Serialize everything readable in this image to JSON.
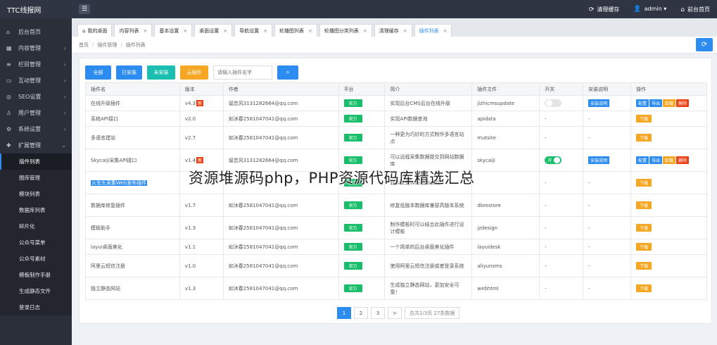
{
  "app": {
    "logo": "TTC线报网"
  },
  "header": {
    "menu_icon": "menu-icon",
    "clear_cache": "清理缓存",
    "user": "admin",
    "frontend": "前台首页"
  },
  "sidebar": {
    "items": [
      {
        "label": "后台首页",
        "icon": "home-icon",
        "chev": ""
      },
      {
        "label": "内容管理",
        "icon": "grid-icon",
        "chev": "›"
      },
      {
        "label": "栏目管理",
        "icon": "list-icon",
        "chev": "›"
      },
      {
        "label": "互动管理",
        "icon": "chat-icon",
        "chev": "›"
      },
      {
        "label": "SEO设置",
        "icon": "seo-icon",
        "chev": "›"
      },
      {
        "label": "用户管理",
        "icon": "user-icon",
        "chev": "›"
      },
      {
        "label": "系统设置",
        "icon": "gear-icon",
        "chev": "›"
      },
      {
        "label": "扩展管理",
        "icon": "puzzle-icon",
        "chev": "⌄"
      }
    ],
    "subitems": [
      "插件列表",
      "图库管理",
      "模块列表",
      "数据库列表",
      "碎片化",
      "公众号菜单",
      "公众号素材",
      "模板制作手册",
      "生成静态文件",
      "登录日志"
    ]
  },
  "tabs": [
    {
      "label": "我的桌面",
      "home": true
    },
    {
      "label": "内容列表"
    },
    {
      "label": "基本设置"
    },
    {
      "label": "桌面设置"
    },
    {
      "label": "导航设置"
    },
    {
      "label": "轮播图列表"
    },
    {
      "label": "轮播图分类列表"
    },
    {
      "label": "清理缓存"
    },
    {
      "label": "插件列表",
      "active": true
    }
  ],
  "breadcrumb": [
    "首页",
    "插件管理",
    "插件列表"
  ],
  "toolbar": {
    "all": "全部",
    "installed": "已安装",
    "not_installed": "未安装",
    "cloud": "云插件",
    "search_placeholder": "请输入插件名字"
  },
  "table": {
    "headers": [
      "插件名",
      "版本",
      "作者",
      "平台",
      "简介",
      "插件文件",
      "开关",
      "安装说明",
      "操作"
    ],
    "rows": [
      {
        "name": "在线升级插件",
        "version": "v4.3",
        "badge": "新",
        "author": "留恋风3131282664@qq.com",
        "platform": "官方",
        "intro": "实现后台CMS后台在线升级",
        "file": "jizhicmsupdate",
        "switch": "off",
        "explain": "安装说明",
        "ops": [
          "配置",
          "导出",
          "卸载",
          "删除"
        ]
      },
      {
        "name": "系统API接口",
        "version": "v2.0",
        "badge": "",
        "author": "如沐春2581047041@qq.com",
        "platform": "官方",
        "intro": "实现API数据查询",
        "file": "apidata",
        "switch": "-",
        "explain": "-",
        "ops": [
          "下载"
        ]
      },
      {
        "name": "多语言建站",
        "version": "v2.7",
        "badge": "",
        "author": "如沐春2581047041@qq.com",
        "platform": "官方",
        "intro": "一种更为巧妙的方式制作多语言站点",
        "file": "mutsite",
        "switch": "-",
        "explain": "-",
        "ops": [
          "下载"
        ]
      },
      {
        "name": "Skycaiji采集API接口",
        "version": "v1.4",
        "badge": "新",
        "author": "留恋风3131282664@qq.com",
        "platform": "官方",
        "intro": "可以远程采集数据提交到网站数据库",
        "file": "skycaiji",
        "switch": "on",
        "switch_label": "开",
        "explain": "安装说明",
        "ops": [
          "配置",
          "导出",
          "卸载",
          "删除"
        ]
      },
      {
        "name": "火车头采集Web发布插件",
        "version": "",
        "badge": "",
        "author": "",
        "platform": "官方",
        "intro": "软件采集Web发布文件",
        "file": "",
        "switch": "-",
        "explain": "-",
        "ops": [
          "下载"
        ],
        "highlight": true
      },
      {
        "name": "数据库修复插件",
        "version": "v1.7",
        "badge": "",
        "author": "如沐春2581047041@qq.com",
        "platform": "官方",
        "intro": "修复低版本数据库兼容高版本系统",
        "file": "dbrestore",
        "switch": "-",
        "explain": "-",
        "ops": [
          "下载"
        ]
      },
      {
        "name": "模板助手",
        "version": "v1.3",
        "badge": "",
        "author": "如沐春2581047041@qq.com",
        "platform": "官方",
        "intro": "制作模板时可以结合此插件进行设计模板",
        "file": "jzdesign",
        "switch": "-",
        "explain": "-",
        "ops": [
          "下载"
        ]
      },
      {
        "name": "layui桌面美化",
        "version": "v1.1",
        "badge": "",
        "author": "如沐春2581047041@qq.com",
        "platform": "官方",
        "intro": "一个简单的后台桌面美化插件",
        "file": "layuidesk",
        "switch": "-",
        "explain": "-",
        "ops": [
          "下载"
        ]
      },
      {
        "name": "阿里云短信注册",
        "version": "v1.0",
        "badge": "",
        "author": "如沐春2581047041@qq.com",
        "platform": "官方",
        "intro": "使用阿里云短信注册或者登录系统",
        "file": "aliyunsms",
        "switch": "-",
        "explain": "-",
        "ops": [
          "下载"
        ]
      },
      {
        "name": "独立静态网站",
        "version": "v1.3",
        "badge": "",
        "author": "如沐春2581047041@qq.com",
        "platform": "官方",
        "intro": "生成独立静态网站，更加安全可靠！",
        "file": "webhtml",
        "switch": "-",
        "explain": "-",
        "ops": [
          "下载"
        ]
      }
    ]
  },
  "pagination": {
    "pages": [
      "1",
      "2",
      "3",
      ">"
    ],
    "active": "1",
    "info": "总共1/3页 27条数据"
  },
  "overlay": "资源堆源码php，PHP资源代码库精选汇总"
}
